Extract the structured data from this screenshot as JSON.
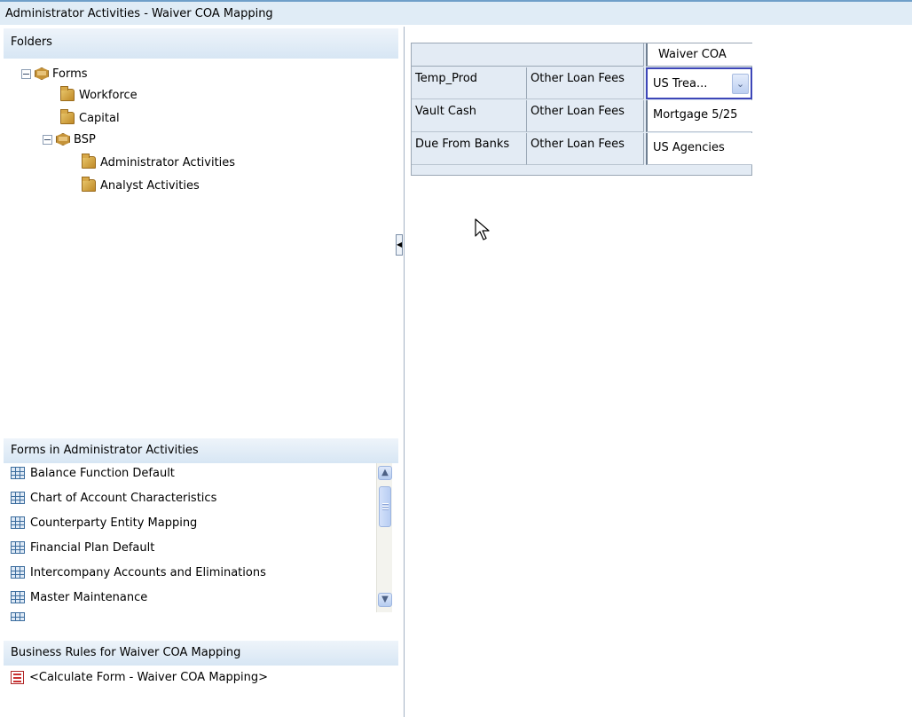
{
  "window": {
    "title": "Administrator Activities - Waiver COA Mapping"
  },
  "folders": {
    "header": "Folders",
    "tree": [
      {
        "label": "Forms",
        "icon": "cube-icon",
        "expanded": true
      },
      {
        "label": "Workforce",
        "icon": "folder-icon"
      },
      {
        "label": "Capital",
        "icon": "folder-icon"
      },
      {
        "label": "BSP",
        "icon": "cube-icon",
        "expanded": true
      },
      {
        "label": "Administrator Activities",
        "icon": "folder-icon"
      },
      {
        "label": "Analyst Activities",
        "icon": "folder-icon"
      }
    ]
  },
  "forms": {
    "header": "Forms in Administrator Activities",
    "items": [
      "Balance Function Default",
      "Chart of Account Characteristics",
      "Counterparty Entity Mapping",
      "Financial Plan Default",
      "Intercompany Accounts and Eliminations",
      "Master Maintenance"
    ],
    "scrollbar": {
      "up": "▲",
      "down": "▼"
    }
  },
  "rules": {
    "header": "Business Rules for Waiver COA Mapping",
    "items": [
      "<Calculate Form - Waiver COA Mapping>"
    ]
  },
  "grid": {
    "column_header": "Waiver COA",
    "rows": [
      {
        "c1": "Temp_Prod",
        "c2": "Other Loan Fees",
        "value": "US Trea...",
        "dropdown": true
      },
      {
        "c1": "Vault Cash",
        "c2": "Other Loan Fees",
        "value": "Mortgage 5/25"
      },
      {
        "c1": "Due From Banks",
        "c2": "Other Loan Fees",
        "value": "US Agencies"
      }
    ],
    "dropdown_glyph": "⌄"
  },
  "splitter": {
    "collapse_glyph": "◀"
  },
  "colors": {
    "accent": "#6f9fc9",
    "header_bg": "#d7e6f4",
    "selection": "#3d46b8"
  }
}
